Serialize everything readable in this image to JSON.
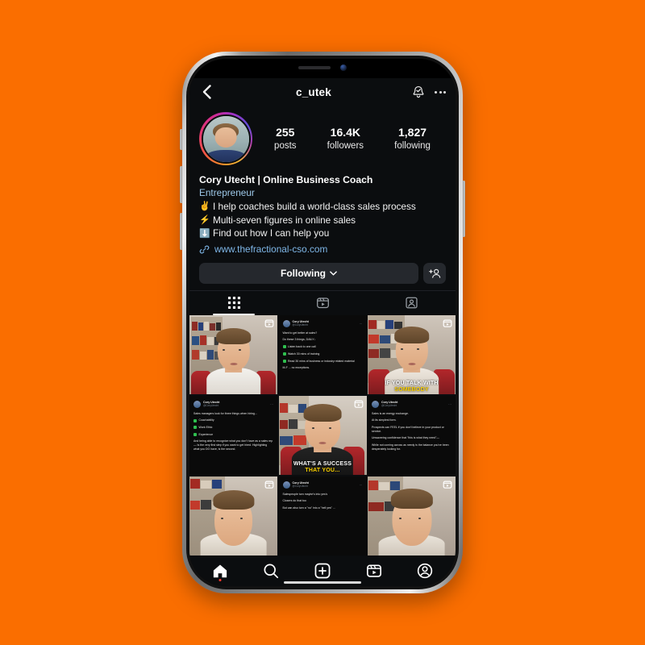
{
  "background_color": "#fa6e00",
  "device": {
    "name": "iphone-mockup",
    "frame_color": "#b9b9b9"
  },
  "app": {
    "name": "Instagram",
    "topbar": {
      "back_icon": "chevron-left-icon",
      "title": "c_utek",
      "notify_icon": "bell-check-icon",
      "more_icon": "ellipsis-icon"
    },
    "profile": {
      "avatar_alt": "profile-photo",
      "stats": [
        {
          "num": "255",
          "label": "posts"
        },
        {
          "num": "16.4K",
          "label": "followers"
        },
        {
          "num": "1,827",
          "label": "following"
        }
      ],
      "name": "Cory Utecht | Online Business Coach",
      "category": "Entrepreneur",
      "bio_lines": [
        {
          "emoji": "✌️",
          "text": "I help coaches build a world-class sales process"
        },
        {
          "emoji": "⚡",
          "text": "Multi-seven figures in online sales"
        },
        {
          "emoji": "⬇️",
          "text": "Find out how I can help you"
        }
      ],
      "link": "www.thefractional-cso.com",
      "link_icon": "link-icon"
    },
    "actions": {
      "follow_label": "Following",
      "follow_chevron": "chevron-down-icon",
      "add_person_icon": "add-person-icon"
    },
    "tabs": [
      {
        "name": "grid",
        "icon": "grid-icon",
        "active": true
      },
      {
        "name": "reels",
        "icon": "reels-icon",
        "active": false
      },
      {
        "name": "tagged",
        "icon": "tagged-person-icon",
        "active": false
      }
    ],
    "grid": [
      {
        "type": "video",
        "badge": "reels-icon",
        "caption": "",
        "caption_hi": ""
      },
      {
        "type": "tweet",
        "author": "Cory Utecht",
        "handle": "@CoryUtecht",
        "paras": [
          "Want to get better at sales?",
          "Do these 3 things, DAILY↓"
        ],
        "checks": [
          "Listen back to one call",
          "Watch 30 mins of training",
          "Read 30 mins of business or industry related material"
        ],
        "footer": "M-F ... no exceptions."
      },
      {
        "type": "video",
        "badge": "reels-icon",
        "caption": "IF YOU TALK WITH",
        "caption_hi": "SOMEBODY"
      },
      {
        "type": "tweet",
        "author": "Cory Utecht",
        "handle": "@CoryUtecht",
        "paras": [
          "Sales managers look for three things when hiring..."
        ],
        "checks": [
          "Coachability",
          "Work Ethic",
          "Experience"
        ],
        "footer": "And being able to recognize what you don't have as a sales rep—  Is the very first step if you want to get hired.  Highlighting what you DO have, is the second."
      },
      {
        "type": "video",
        "badge": "reels-icon",
        "caption": "WHAT'S A SUCCESS",
        "caption_hi": "THAT YOU..."
      },
      {
        "type": "tweet",
        "author": "Cory Utecht",
        "handle": "@CoryUtecht",
        "paras": [
          "Sales is an energy exchange.",
          "At its simplest form.",
          "Prospects can FEEL if you don't believe in your product or service.",
          "Unwavering confidence that \"this is what they need\"—",
          "While not coming across as needy is the balance you've been desperately looking for."
        ],
        "checks": [],
        "footer": ""
      },
      {
        "type": "video",
        "badge": "reels-icon",
        "caption": "",
        "caption_hi": ""
      },
      {
        "type": "tweet",
        "author": "Cory Utecht",
        "handle": "@CoryUtecht",
        "paras": [
          "Salespeople turn maybe's into yes's",
          "Closers do that too",
          "But can also turn a \"no\" into a \"hell yes\" ..."
        ],
        "checks": [],
        "footer": ""
      },
      {
        "type": "video",
        "badge": "reels-icon",
        "caption": "",
        "caption_hi": ""
      }
    ],
    "bottomnav": [
      {
        "name": "home",
        "icon": "home-icon",
        "active": true,
        "dot": true
      },
      {
        "name": "search",
        "icon": "search-icon",
        "active": false,
        "dot": false
      },
      {
        "name": "create",
        "icon": "plus-box-icon",
        "active": false,
        "dot": false
      },
      {
        "name": "reels",
        "icon": "reels-icon",
        "active": false,
        "dot": false
      },
      {
        "name": "profile",
        "icon": "account-circle-icon",
        "active": false,
        "dot": false
      }
    ]
  }
}
